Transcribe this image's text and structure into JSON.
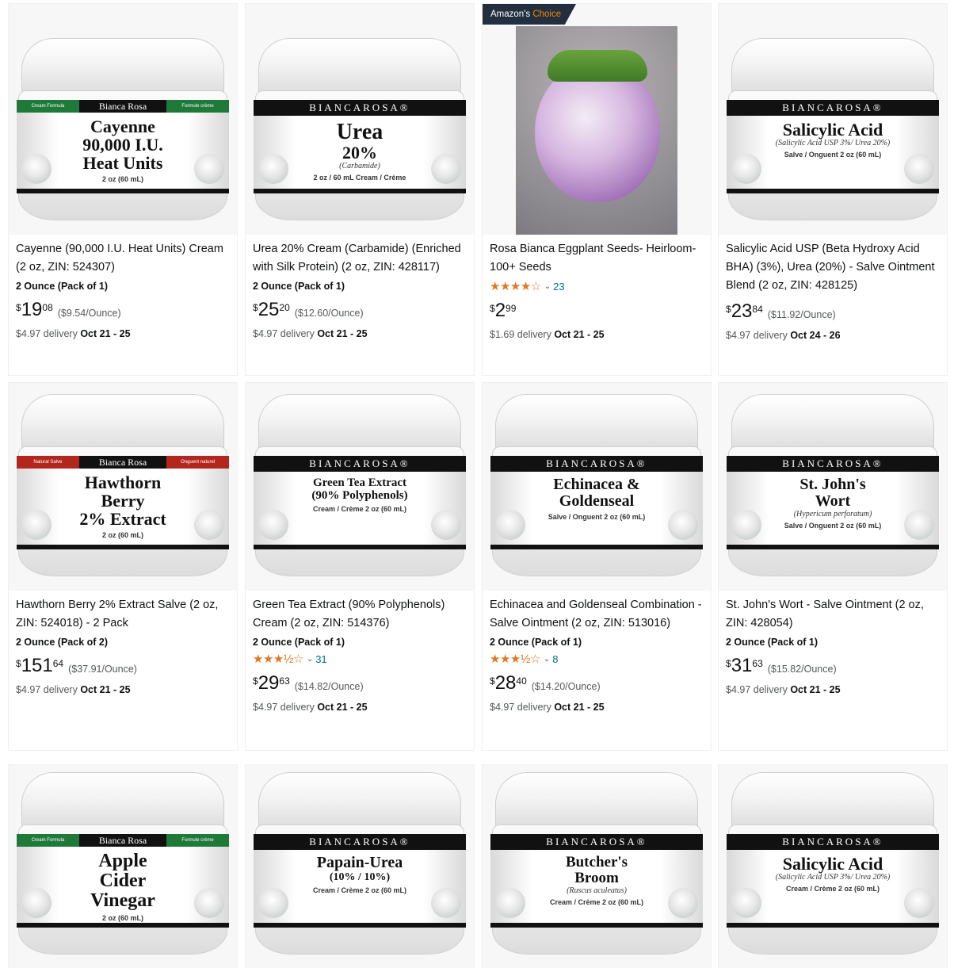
{
  "products": [
    {
      "title": "Cayenne (90,000 I.U. Heat Units) Cream (2 oz, ZIN: 524307)",
      "pack": "2 Ounce (Pack of 1)",
      "price": {
        "symbol": "$",
        "whole": "19",
        "fraction": "08"
      },
      "unit_price": "($9.54/Ounce)",
      "delivery": {
        "prefix": "$4.97 delivery ",
        "dates": "Oct 21 - 25"
      },
      "label": {
        "style": "banner",
        "brand": "Bianca Rosa",
        "side_left": "Cream Formula",
        "side_right": "Formule crème",
        "lines": [
          "Cayenne",
          "90,000 I.U.",
          "Heat Units"
        ],
        "sub": "",
        "foot": "2 oz (60 mL)"
      }
    },
    {
      "title": "Urea 20% Cream (Carbamide) (Enriched with Silk Protein) (2 oz, ZIN: 428117)",
      "pack": "2 Ounce (Pack of 1)",
      "price": {
        "symbol": "$",
        "whole": "25",
        "fraction": "20"
      },
      "unit_price": "($12.60/Ounce)",
      "delivery": {
        "prefix": "$4.97 delivery ",
        "dates": "Oct 21 - 25"
      },
      "label": {
        "style": "classic",
        "brand": "BIANCAROSA®",
        "lines": [
          "Urea",
          "20%"
        ],
        "sub": "(Carbamide)",
        "foot": "2 oz / 60 mL    Cream / Crème"
      }
    },
    {
      "badge": {
        "main": "Amazon's ",
        "accent": "Choice"
      },
      "title": "Rosa Bianca Eggplant Seeds- Heirloom- 100+ Seeds",
      "rating": {
        "stars": "★★★★☆",
        "count": "23"
      },
      "price": {
        "symbol": "$",
        "whole": "2",
        "fraction": "99"
      },
      "delivery": {
        "prefix": "$1.69 delivery ",
        "dates": "Oct 21 - 25"
      }
    },
    {
      "title": "Salicylic Acid USP (Beta Hydroxy Acid BHA) (3%), Urea (20%) - Salve Ointment Blend (2 oz, ZIN: 428125)",
      "price": {
        "symbol": "$",
        "whole": "23",
        "fraction": "84"
      },
      "unit_price": "($11.92/Ounce)",
      "delivery": {
        "prefix": "$4.97 delivery ",
        "dates": "Oct 24 - 26"
      },
      "label": {
        "style": "classic",
        "brand": "BIANCAROSA®",
        "lines": [
          "Salicylic Acid"
        ],
        "sub": "(Salicylic Acid USP 3%/ Urea 20%)",
        "foot": "Salve / Onguent  2 oz (60 mL)"
      }
    },
    {
      "title": "Hawthorn Berry 2% Extract Salve (2 oz, ZIN: 524018) - 2 Pack",
      "pack": "2 Ounce (Pack of 2)",
      "price": {
        "symbol": "$",
        "whole": "151",
        "fraction": "64"
      },
      "unit_price": "($37.91/Ounce)",
      "delivery": {
        "prefix": "$4.97 delivery ",
        "dates": "Oct 21 - 25"
      },
      "label": {
        "style": "banner-red",
        "brand": "Bianca Rosa",
        "side_left": "Natural Salve",
        "side_right": "Onguent naturel",
        "lines": [
          "Hawthorn",
          "Berry",
          "2% Extract"
        ],
        "sub": "",
        "foot": "2 oz (60 mL)"
      }
    },
    {
      "title": "Green Tea Extract (90% Polyphenols) Cream (2 oz, ZIN: 514376)",
      "pack": "2 Ounce (Pack of 1)",
      "rating": {
        "stars": "★★★½☆",
        "count": "31"
      },
      "price": {
        "symbol": "$",
        "whole": "29",
        "fraction": "63"
      },
      "unit_price": "($14.82/Ounce)",
      "delivery": {
        "prefix": "$4.97 delivery ",
        "dates": "Oct 21 - 25"
      },
      "label": {
        "style": "classic",
        "brand": "BIANCAROSA®",
        "lines": [
          "Green Tea Extract",
          "(90% Polyphenols)"
        ],
        "sub": "",
        "foot": "Cream / Crème  2 oz (60 mL)"
      }
    },
    {
      "title": "Echinacea and Goldenseal Combination - Salve Ointment (2 oz, ZIN: 513016)",
      "pack": "2 Ounce (Pack of 1)",
      "rating": {
        "stars": "★★★½☆",
        "count": "8"
      },
      "price": {
        "symbol": "$",
        "whole": "28",
        "fraction": "40"
      },
      "unit_price": "($14.20/Ounce)",
      "delivery": {
        "prefix": "$4.97 delivery ",
        "dates": "Oct 21 - 25"
      },
      "label": {
        "style": "classic",
        "brand": "BIANCAROSA®",
        "lines": [
          "Echinacea &",
          "Goldenseal"
        ],
        "sub": "",
        "foot": "Salve / Onguent  2 oz (60 mL)"
      }
    },
    {
      "title": "St. John's Wort - Salve Ointment (2 oz, ZIN: 428054)",
      "pack": "2 Ounce (Pack of 1)",
      "price": {
        "symbol": "$",
        "whole": "31",
        "fraction": "63"
      },
      "unit_price": "($15.82/Ounce)",
      "delivery": {
        "prefix": "$4.97 delivery ",
        "dates": "Oct 21 - 25"
      },
      "label": {
        "style": "classic",
        "brand": "BIANCAROSA®",
        "lines": [
          "St. John's",
          "Wort"
        ],
        "sub": "(Hypericum perforatum)",
        "foot": "Salve / Onguent  2 oz (60 mL)"
      }
    },
    {
      "label": {
        "style": "banner",
        "brand": "Bianca Rosa",
        "side_left": "Cream Formula",
        "side_right": "Formule crème",
        "lines": [
          "Apple",
          "Cider",
          "Vinegar"
        ],
        "sub": "",
        "foot": "2 oz (60 mL)"
      }
    },
    {
      "label": {
        "style": "classic",
        "brand": "BIANCAROSA®",
        "lines": [
          "Papain-Urea",
          "(10% / 10%)"
        ],
        "sub": "",
        "foot": "Cream / Crème  2 oz (60 mL)"
      }
    },
    {
      "label": {
        "style": "classic",
        "brand": "BIANCAROSA®",
        "lines": [
          "Butcher's",
          "Broom"
        ],
        "sub": "(Ruscus aculeatus)",
        "foot": "Cream / Crème  2 oz (60 mL)"
      }
    },
    {
      "label": {
        "style": "classic",
        "brand": "BIANCAROSA®",
        "lines": [
          "Salicylic Acid"
        ],
        "sub": "(Salicylic Acid USP 3%/ Urea 20%)",
        "foot": "Cream / Crème  2 oz (60 mL)"
      }
    }
  ],
  "colors": {
    "link": "#007185",
    "star": "#de7921",
    "badge_bg": "#232f3e",
    "badge_accent": "#f08804",
    "banner_green": "#1f7a3a",
    "banner_red": "#b3261e"
  }
}
